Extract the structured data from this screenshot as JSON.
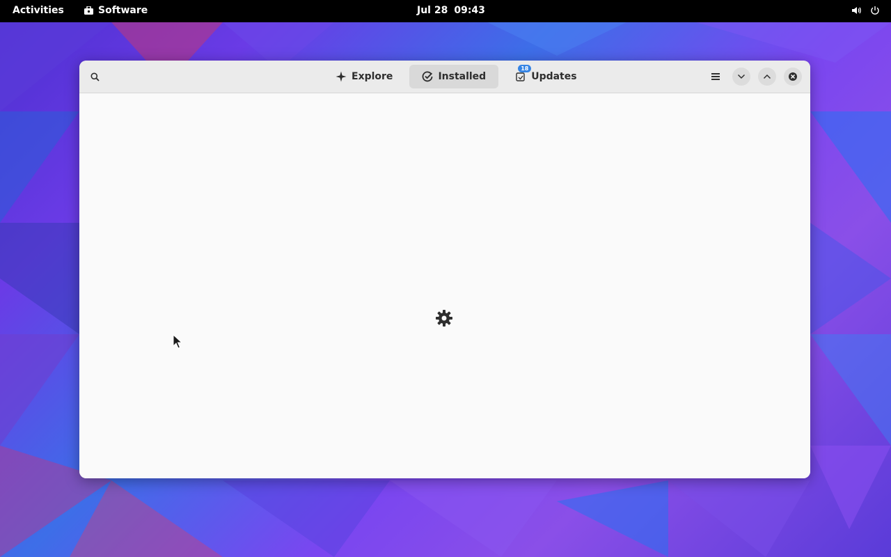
{
  "topbar": {
    "activities_label": "Activities",
    "app_name": "Software",
    "date": "Jul 28",
    "time": "09:43",
    "tray_icons": [
      "volume-icon",
      "power-icon"
    ]
  },
  "window": {
    "tabs": [
      {
        "label": "Explore",
        "icon": "explore-icon",
        "active": false
      },
      {
        "label": "Installed",
        "icon": "installed-check-icon",
        "active": true
      },
      {
        "label": "Updates",
        "icon": "updates-icon",
        "active": false,
        "badge": "18"
      }
    ],
    "headerbar_buttons": [
      "menu-icon",
      "minimize-icon",
      "maximize-icon",
      "close-icon"
    ],
    "content_state": "loading",
    "colors": {
      "badge": "#3584e4",
      "active_tab_bg": "#d9d9d9",
      "headerbar_bg": "#ebebeb",
      "content_bg": "#fafafa"
    }
  }
}
